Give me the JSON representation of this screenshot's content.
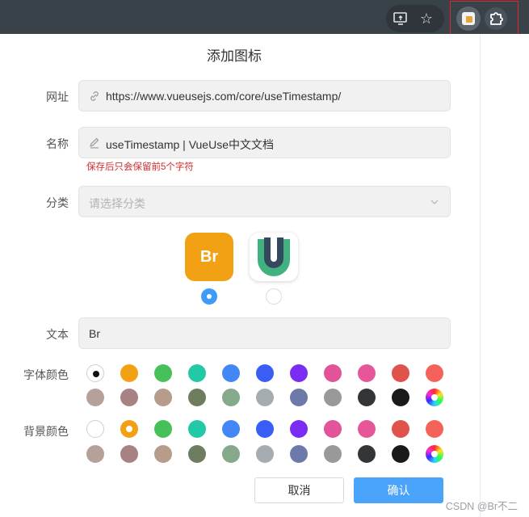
{
  "browser": {
    "toolbar_icons": [
      "screen-share-icon",
      "star-icon"
    ],
    "extensions": [
      "extension-favicon-icon",
      "puzzle-icon"
    ]
  },
  "dialog": {
    "title": "添加图标",
    "url": {
      "label": "网址",
      "value": "https://www.vueusejs.com/core/useTimestamp/",
      "icon": "link-icon"
    },
    "name": {
      "label": "名称",
      "value": "useTimestamp | VueUse中文文档",
      "icon": "pencil-icon",
      "hint": "保存后只会保留前5个字符"
    },
    "category": {
      "label": "分类",
      "placeholder": "请选择分类"
    },
    "icon_options": [
      {
        "text": "Br",
        "bg": "#f2a115",
        "selected": true
      },
      {
        "text": "",
        "name": "vueuse-logo",
        "selected": false
      }
    ],
    "text": {
      "label": "文本",
      "value": "Br"
    },
    "font_color": {
      "label": "字体颜色"
    },
    "bg_color": {
      "label": "背景颜色"
    },
    "palette_row1": [
      "#ffffff",
      "#f2a115",
      "#46c15a",
      "#22c9a6",
      "#4287f5",
      "#3a5ef5",
      "#7a2cf2",
      "#e2539a",
      "#e6579a",
      "#e0524c",
      "#f5625a"
    ],
    "palette_row2": [
      "#b5a199",
      "#a88283",
      "#b79b8b",
      "#6e7d60",
      "#86a88b",
      "#a5adb0",
      "#6b7aa8",
      "#999999",
      "#343536",
      "#1a1a1a",
      "wheel"
    ],
    "cancel_label": "取消",
    "confirm_label": "确认"
  },
  "watermark": "CSDN @Br不二"
}
